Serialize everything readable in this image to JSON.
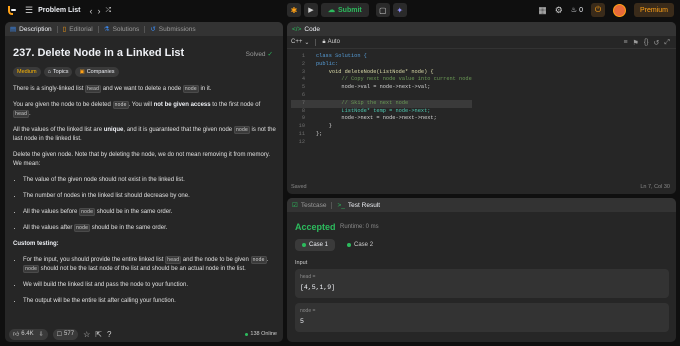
{
  "topnav": {
    "problem_list_label": "Problem List",
    "submit_label": "Submit",
    "streak_count": "0",
    "premium_label": "Premium"
  },
  "left": {
    "tabs": [
      "Description",
      "Editorial",
      "Solutions",
      "Submissions"
    ],
    "title": "237. Delete Node in a Linked List",
    "status": "Solved",
    "tags": [
      "Medium",
      "Topics",
      "Companies"
    ],
    "p1a": "There is a singly-linked list ",
    "p1code": "head",
    "p1b": " and we want to delete a node ",
    "p1code2": "node",
    "p1c": " in it.",
    "p2a": "You are given the node to be deleted ",
    "p2code": "node",
    "p2b": ". You will ",
    "p2bold": "not be given access",
    "p2c": " to the first node of ",
    "p2code2": "head",
    "p2d": ".",
    "p3a": "All the values of the linked list are ",
    "p3bold": "unique",
    "p3b": ", and it is guaranteed that the given node ",
    "p3code": "node",
    "p3c": " is not the last node in the linked list.",
    "p4": "Delete the given node. Note that by deleting the node, we do not mean removing it from memory. We mean:",
    "b1": "The value of the given node should not exist in the linked list.",
    "b2": "The number of nodes in the linked list should decrease by one.",
    "b3a": "All the values before ",
    "b3code": "node",
    "b3b": " should be in the same order.",
    "b4a": "All the values after ",
    "b4code": "node",
    "b4b": " should be in the same order.",
    "custom_heading": "Custom testing:",
    "c1a": "For the input, you should provide the entire linked list ",
    "c1code": "head",
    "c1b": " and the node to be given ",
    "c1code2": "node",
    "c1c": ". ",
    "c1code3": "node",
    "c1d": " should not be the last node of the list and should be an actual node in the list.",
    "c2": "We will build the linked list and pass the node to your function.",
    "c3": "The output will be the entire list after calling your function.",
    "likes": "6.4K",
    "comments": "577",
    "online": "138 Online"
  },
  "code": {
    "tab_label": "Code",
    "language": "C++",
    "mode": "Auto",
    "lines": [
      "class Solution {",
      "public:",
      "    void deleteNode(ListNode* node) {",
      "        // Copy next node value into current node",
      "        node->val = node->next->val;",
      "",
      "        // Skip the next node",
      "        ListNode* temp = node->next;",
      "        node->next = node->next->next;",
      "    }",
      "};",
      ""
    ],
    "saved": "Saved",
    "cursor": "Ln 7, Col 30"
  },
  "test": {
    "tabs": [
      "Testcase",
      "Test Result"
    ],
    "verdict": "Accepted",
    "runtime": "Runtime: 0 ms",
    "cases": [
      "Case 1",
      "Case 2"
    ],
    "input_label": "Input",
    "head_label": "head =",
    "head_value": "[4,5,1,9]",
    "node_label": "node =",
    "node_value": "5"
  },
  "colors": {
    "accent": "#ffa116",
    "success": "#2cbb5d",
    "medium": "#ffb800",
    "panel": "#262626",
    "background": "#0f0f0f"
  }
}
